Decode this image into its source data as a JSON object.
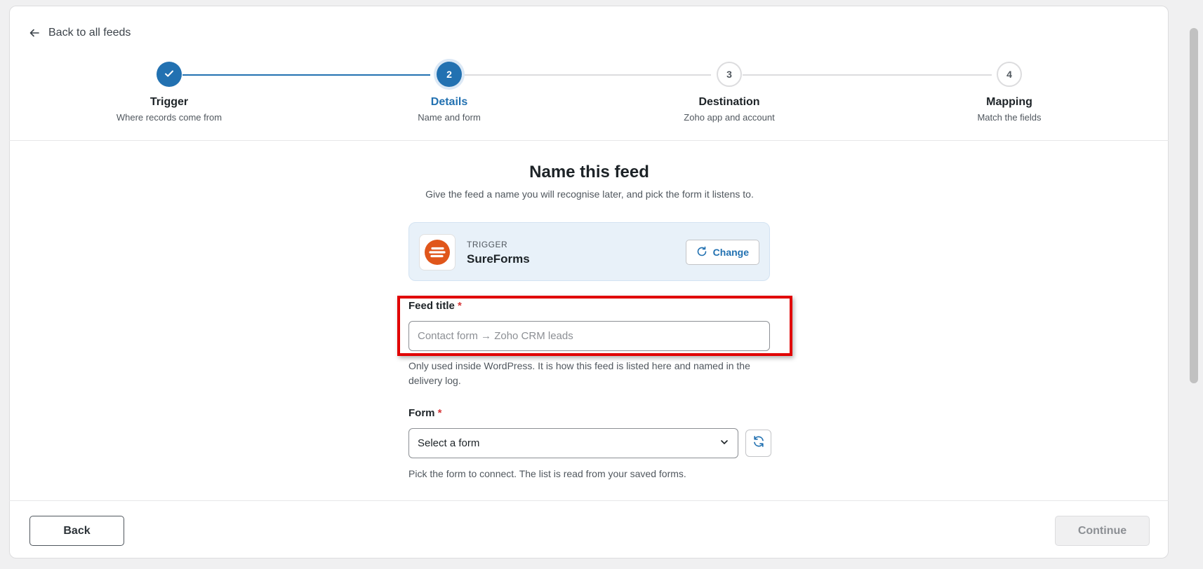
{
  "nav": {
    "back_label": "Back to all feeds"
  },
  "stepper": {
    "steps": [
      {
        "number": "1",
        "label": "Trigger",
        "sub": "Where records come from",
        "state": "done"
      },
      {
        "number": "2",
        "label": "Details",
        "sub": "Name and form",
        "state": "active"
      },
      {
        "number": "3",
        "label": "Destination",
        "sub": "Zoho app and account",
        "state": "todo"
      },
      {
        "number": "4",
        "label": "Mapping",
        "sub": "Match the fields",
        "state": "todo"
      }
    ]
  },
  "main": {
    "title": "Name this feed",
    "subtitle": "Give the feed a name you will recognise later, and pick the form it listens to."
  },
  "trigger": {
    "eyebrow": "TRIGGER",
    "name": "SureForms",
    "change_label": "Change",
    "logo_color": "#e0561b"
  },
  "feed_title": {
    "label": "Feed title",
    "required_mark": "*",
    "placeholder": "Contact form → Zoho CRM leads",
    "value": "",
    "help": "Only used inside WordPress. It is how this feed is listed here and named in the delivery log."
  },
  "form": {
    "label": "Form",
    "required_mark": "*",
    "selected": "Select a form",
    "help": "Pick the form to connect. The list is read from your saved forms."
  },
  "footer": {
    "back_label": "Back",
    "continue_label": "Continue"
  },
  "colors": {
    "accent": "#2271b1",
    "highlight": "#e10000",
    "required": "#d63638"
  }
}
